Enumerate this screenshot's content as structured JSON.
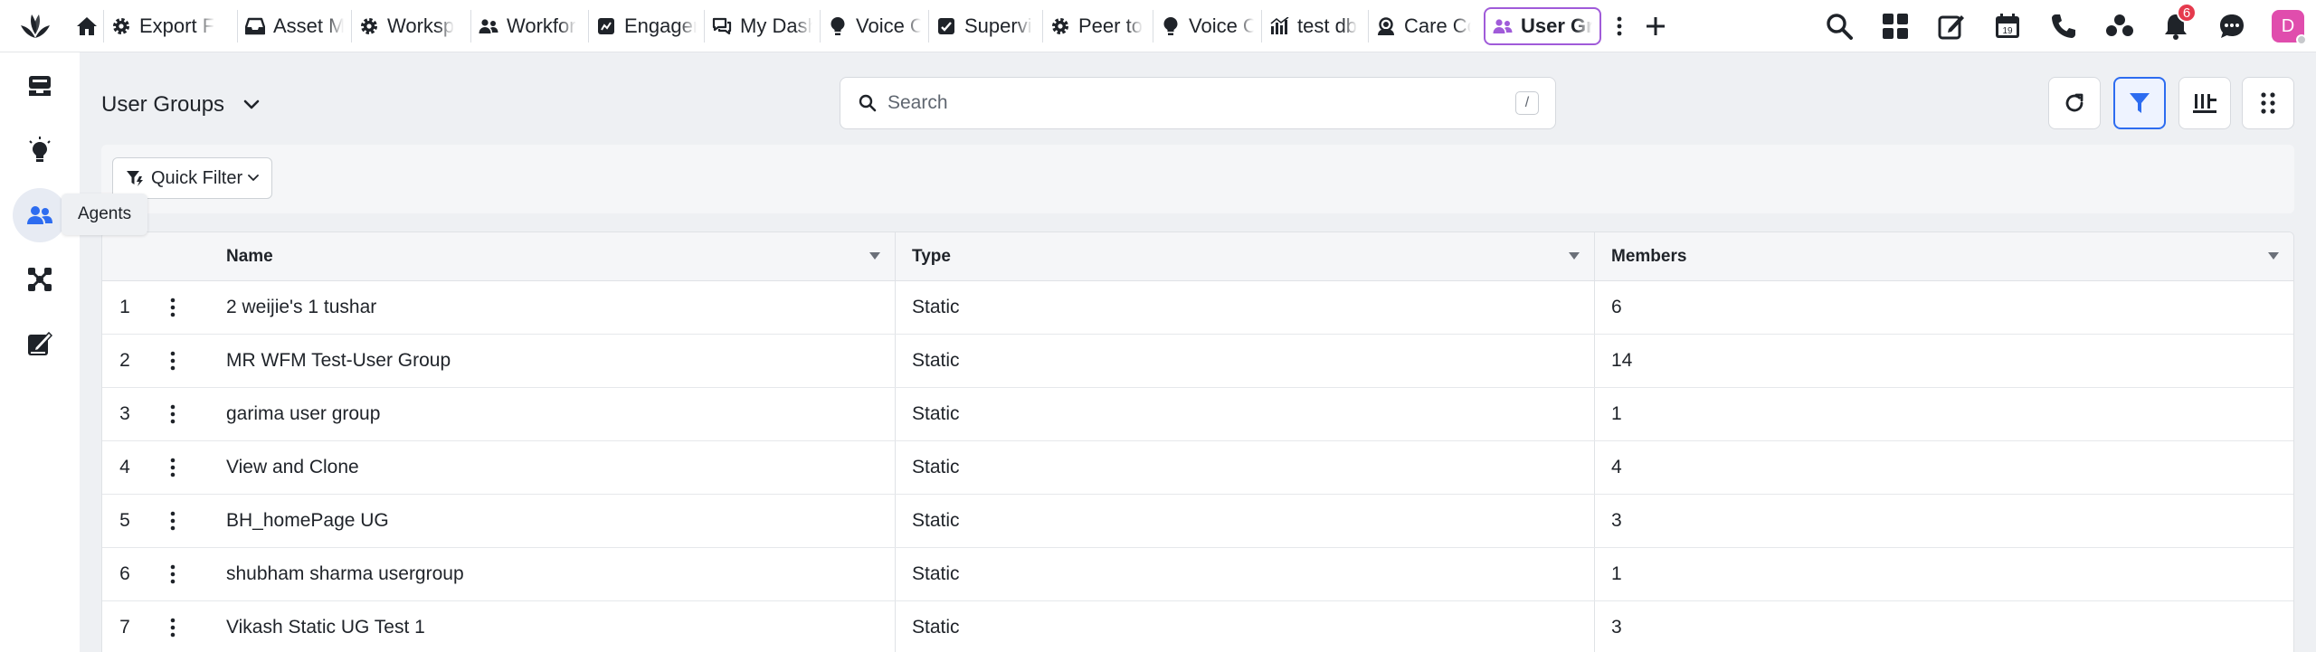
{
  "tabs": [
    {
      "icon": "gear-icon",
      "label": "Export F"
    },
    {
      "icon": "inbox-icon",
      "label": "Asset M"
    },
    {
      "icon": "gear-icon",
      "label": "Worksp"
    },
    {
      "icon": "users-icon",
      "label": "Workfor"
    },
    {
      "icon": "engage-icon",
      "label": "Engager"
    },
    {
      "icon": "chat-icon",
      "label": "My Dash"
    },
    {
      "icon": "bulb-icon",
      "label": "Voice C"
    },
    {
      "icon": "supervisor-icon",
      "label": "Supervi"
    },
    {
      "icon": "gear-icon",
      "label": "Peer to"
    },
    {
      "icon": "bulb-icon",
      "label": "Voice C"
    },
    {
      "icon": "chart-icon",
      "label": "test db"
    },
    {
      "icon": "headset-icon",
      "label": "Care Co"
    },
    {
      "icon": "users-icon",
      "label": "User Gr",
      "active": true
    }
  ],
  "header": {
    "notification_count": "6",
    "calendar_day": "19",
    "avatar_letter": "D"
  },
  "rail": {
    "tooltip": "Agents"
  },
  "page": {
    "title": "User Groups"
  },
  "search": {
    "placeholder": "Search",
    "shortcut": "/"
  },
  "filter": {
    "quick_filter_label": "Quick Filter"
  },
  "table": {
    "columns": [
      "Name",
      "Type",
      "Members"
    ],
    "rows": [
      {
        "index": "1",
        "name": "2 weijie's 1 tushar",
        "type": "Static",
        "members": "6"
      },
      {
        "index": "2",
        "name": "MR WFM Test-User Group",
        "type": "Static",
        "members": "14"
      },
      {
        "index": "3",
        "name": "garima user group",
        "type": "Static",
        "members": "1"
      },
      {
        "index": "4",
        "name": "View and Clone",
        "type": "Static",
        "members": "4"
      },
      {
        "index": "5",
        "name": "BH_homePage UG",
        "type": "Static",
        "members": "3"
      },
      {
        "index": "6",
        "name": "shubham sharma usergroup",
        "type": "Static",
        "members": "1"
      },
      {
        "index": "7",
        "name": "Vikash Static UG Test 1",
        "type": "Static",
        "members": "3"
      }
    ]
  },
  "colors": {
    "accent": "#2d6cf0",
    "active_tab_border": "#a05bd9",
    "badge": "#e53a4d",
    "avatar": "#e04dad"
  }
}
